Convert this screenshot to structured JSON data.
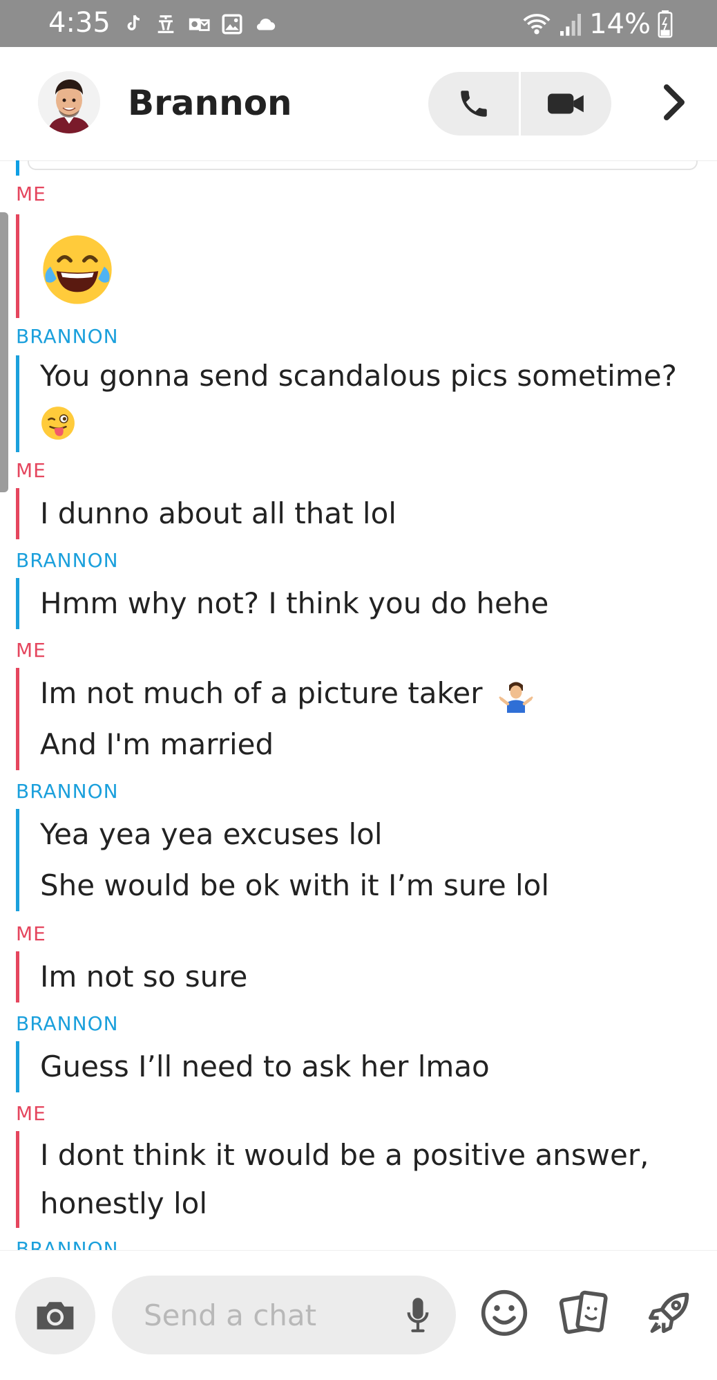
{
  "status_bar": {
    "time": "4:35",
    "battery": "14%",
    "icons": [
      "tiktok-icon",
      "news-icon",
      "outlook-icon",
      "gallery-icon",
      "cloud-icon",
      "wifi-icon",
      "signal-icon",
      "battery-icon"
    ]
  },
  "header": {
    "contact_name": "Brannon"
  },
  "messages": [
    {
      "sender": "ME",
      "kind": "emoji",
      "emoji": "face-with-tears-of-joy"
    },
    {
      "sender": "BRANNON",
      "kind": "text",
      "lines": [
        "You gonna send scandalous pics sometime?"
      ],
      "emoji": "winking-face-with-tongue"
    },
    {
      "sender": "ME",
      "kind": "text",
      "lines": [
        "I dunno about all that lol"
      ]
    },
    {
      "sender": "BRANNON",
      "kind": "text",
      "lines": [
        "Hmm why not? I think you do hehe"
      ]
    },
    {
      "sender": "ME",
      "kind": "text",
      "lines": [
        "Im not much of a picture taker",
        "And I'm married"
      ],
      "emoji": "person-shrugging"
    },
    {
      "sender": "BRANNON",
      "kind": "text",
      "lines": [
        "Yea yea yea excuses lol",
        "She would be ok with it I’m sure lol"
      ]
    },
    {
      "sender": "ME",
      "kind": "text",
      "lines": [
        "Im not so sure"
      ]
    },
    {
      "sender": "BRANNON",
      "kind": "text",
      "lines": [
        "Guess I’ll need to ask her lmao"
      ]
    },
    {
      "sender": "ME",
      "kind": "text",
      "lines": [
        "I dont think it would be a positive answer,",
        "honestly lol"
      ]
    },
    {
      "sender": "BRANNON",
      "kind": "partial",
      "lines": []
    }
  ],
  "input": {
    "placeholder": "Send a chat"
  },
  "colors": {
    "me": "#e5465e",
    "them": "#1ba0dc",
    "status_bar": "#8e8e8e",
    "pill": "#ececec"
  }
}
